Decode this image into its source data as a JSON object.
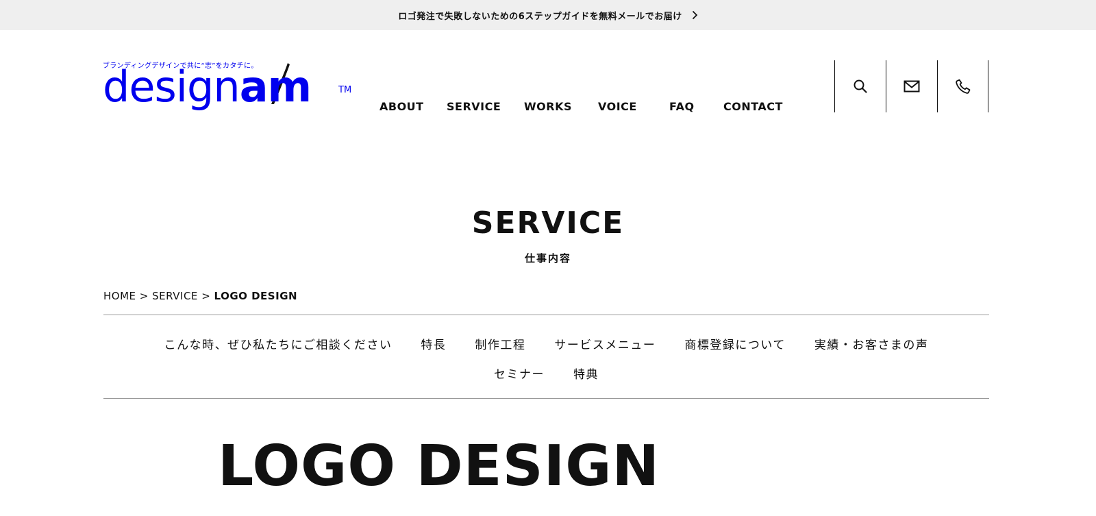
{
  "topbar": {
    "text": "ロゴ発注で失敗しないための6ステップガイドを無料メールでお届け",
    "arrow_icon": "chevron-right-icon"
  },
  "logo": {
    "tagline": "ブランディングデザインで共に“志”をカタチに。",
    "word_light": "design",
    "word_bold": "am",
    "tm": "TM"
  },
  "nav": {
    "items": [
      "ABOUT",
      "SERVICE",
      "WORKS",
      "VOICE",
      "FAQ",
      "CONTACT"
    ]
  },
  "header_icons": [
    "search-icon",
    "mail-icon",
    "phone-icon"
  ],
  "hero": {
    "title": "SERVICE",
    "subtitle": "仕事内容"
  },
  "breadcrumb": {
    "home": "HOME",
    "sep": ">",
    "section": "SERVICE",
    "current": "LOGO DESIGN"
  },
  "anchors": {
    "row1": [
      "こんな時、ぜひ私たちにご相談ください",
      "特長",
      "制作工程",
      "サービスメニュー",
      "商標登録について",
      "実績・お客さまの声"
    ],
    "row2": [
      "セミナー",
      "特典"
    ]
  },
  "page": {
    "title": "LOGO DESIGN"
  },
  "colors": {
    "topbar_bg": "#efefef",
    "text": "#111111",
    "rule": "#999999"
  }
}
